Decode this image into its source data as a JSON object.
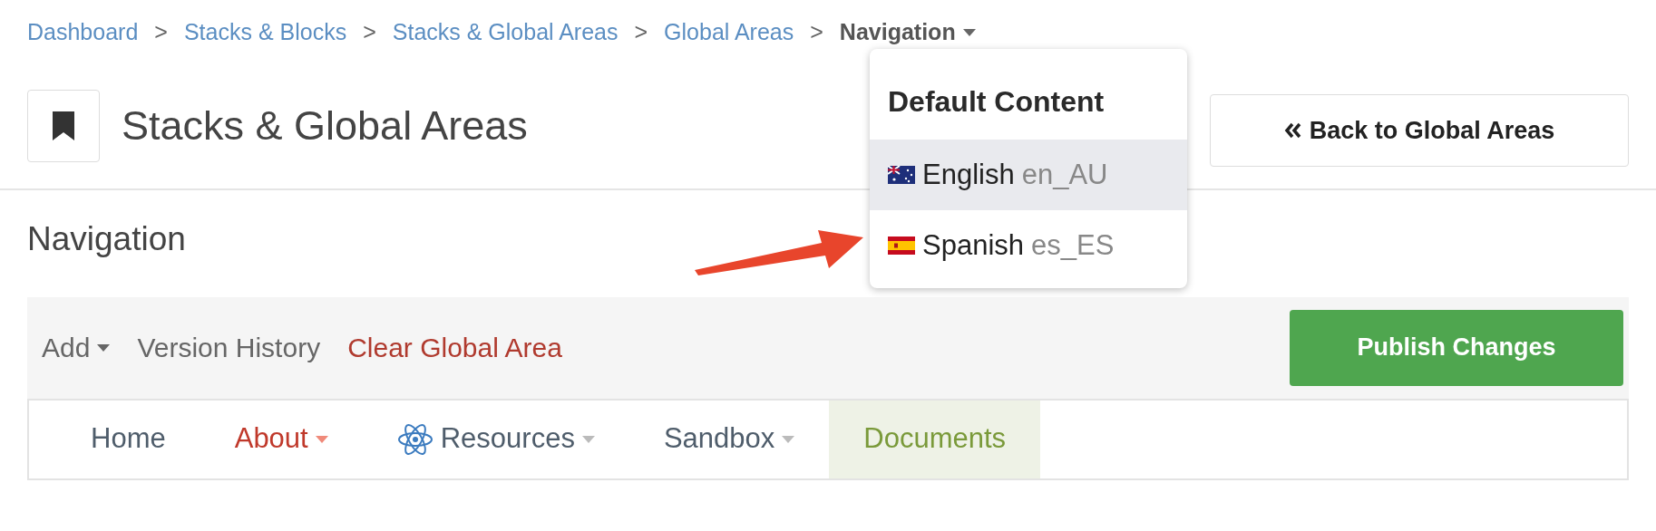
{
  "breadcrumb": {
    "links": [
      "Dashboard",
      "Stacks & Blocks",
      "Stacks & Global Areas",
      "Global Areas"
    ],
    "separator": ">",
    "current": "Navigation"
  },
  "header": {
    "title": "Stacks & Global Areas",
    "back_button": "Back to Global Areas"
  },
  "language_menu": {
    "heading": "Default Content",
    "items": [
      {
        "kind": "au",
        "name": "English",
        "code": "en_AU",
        "selected": true
      },
      {
        "kind": "es",
        "name": "Spanish",
        "code": "es_ES",
        "selected": false
      }
    ]
  },
  "section_title": "Navigation",
  "toolbar": {
    "add": "Add",
    "version_history": "Version History",
    "clear": "Clear Global Area",
    "publish": "Publish Changes"
  },
  "nav": [
    {
      "label": "Home",
      "color": "#4f5d6b",
      "icon": false,
      "dropdown": false,
      "selected": false
    },
    {
      "label": "About",
      "color": "#c0392b",
      "icon": false,
      "dropdown": true,
      "selected": false
    },
    {
      "label": "Resources",
      "color": "#4f5d6b",
      "icon": true,
      "dropdown": true,
      "selected": false
    },
    {
      "label": "Sandbox",
      "color": "#4f5d6b",
      "icon": false,
      "dropdown": true,
      "selected": false
    },
    {
      "label": "Documents",
      "color": "#7a9a3a",
      "icon": false,
      "dropdown": false,
      "selected": true
    }
  ]
}
